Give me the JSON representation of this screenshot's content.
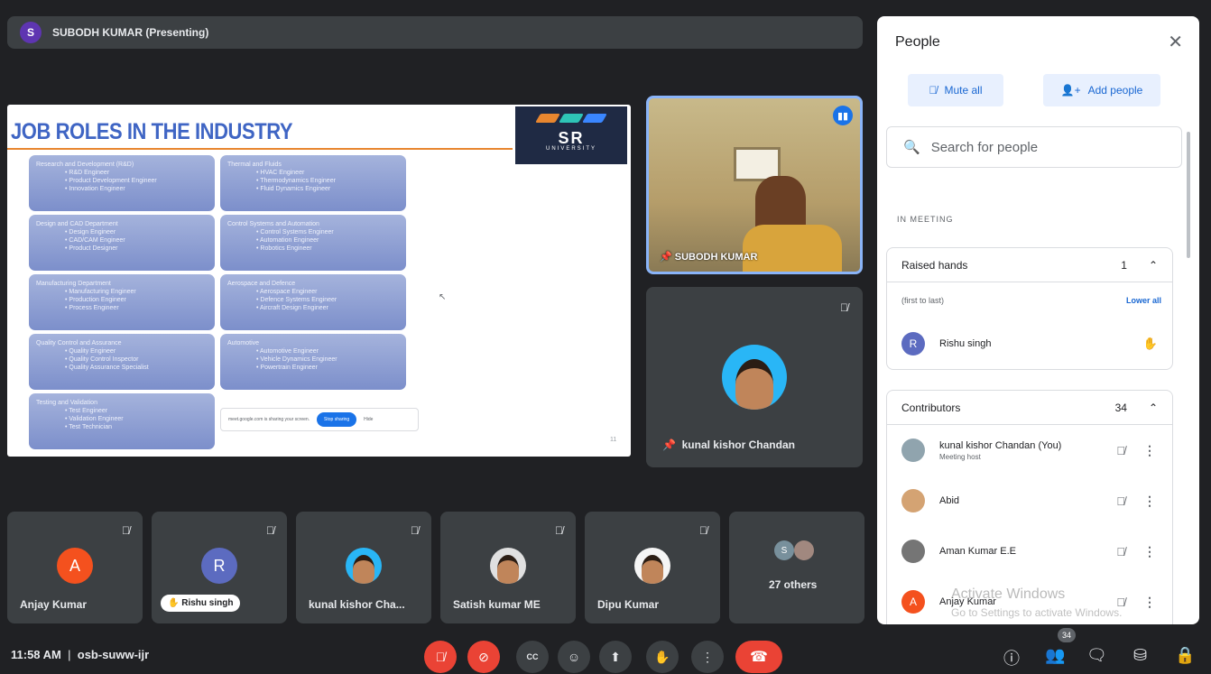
{
  "presenter": {
    "initial": "S",
    "label": "SUBODH KUMAR (Presenting)"
  },
  "slide": {
    "title": "JOB ROLES IN THE INDUSTRY",
    "logo": {
      "name": "SR",
      "sub": "UNIVERSITY"
    },
    "cards": [
      {
        "heading": "Research and Development (R&D)",
        "items": [
          "R&D Engineer",
          "Product Development Engineer",
          "Innovation Engineer"
        ]
      },
      {
        "heading": "Thermal and Fluids",
        "items": [
          "HVAC Engineer",
          "Thermodynamics Engineer",
          "Fluid Dynamics Engineer"
        ]
      },
      {
        "heading": "Design and CAD Department",
        "items": [
          "Design Engineer",
          "CAD/CAM Engineer",
          "Product Designer"
        ]
      },
      {
        "heading": "Control Systems and Automation",
        "items": [
          "Control Systems Engineer",
          "Automation Engineer",
          "Robotics Engineer"
        ]
      },
      {
        "heading": "Manufacturing Department",
        "items": [
          "Manufacturing Engineer",
          "Production Engineer",
          "Process Engineer"
        ]
      },
      {
        "heading": "Aerospace and Defence",
        "items": [
          "Aerospace Engineer",
          "Defence Systems Engineer",
          "Aircraft Design Engineer"
        ]
      },
      {
        "heading": "Quality Control and Assurance",
        "items": [
          "Quality Engineer",
          "Quality Control Inspector",
          "Quality Assurance Specialist"
        ]
      },
      {
        "heading": "Automotive",
        "items": [
          "Automotive Engineer",
          "Vehicle Dynamics Engineer",
          "Powertrain Engineer"
        ]
      },
      {
        "heading": "Testing and Validation",
        "items": [
          "Test Engineer",
          "Validation Engineer",
          "Test Technician"
        ]
      }
    ],
    "share_bar": {
      "text": "meet.google.com is sharing your screen.",
      "stop": "Stop sharing",
      "hide": "Hide"
    },
    "page_number": "11"
  },
  "tiles": {
    "subodh": {
      "name": "SUBODH KUMAR"
    },
    "kunal": {
      "name": "kunal kishor Chandan"
    }
  },
  "participants": [
    {
      "name": "Anjay Kumar",
      "initial": "A",
      "color": "#f4511e"
    },
    {
      "name": "Rishu singh",
      "initial": "R",
      "color": "#5c6bc0",
      "hand": true
    },
    {
      "name": "kunal kishor Cha...",
      "initial": "",
      "color": "#29b6f6"
    },
    {
      "name": "Satish kumar ME",
      "initial": "",
      "color": "#e0e0e0"
    },
    {
      "name": "Dipu Kumar",
      "initial": "",
      "color": "#f5f5f5"
    }
  ],
  "others": {
    "label": "27 others",
    "mini_initial": "S"
  },
  "controls": {
    "time": "11:58 AM",
    "separator": "|",
    "meeting_code": "osb-suww-ijr",
    "cc_label": "CC"
  },
  "panel": {
    "title": "People",
    "mute_all": "Mute all",
    "add_people": "Add people",
    "search_placeholder": "Search for people",
    "in_meeting": "IN MEETING",
    "people_badge": "34",
    "raised_hands": {
      "title": "Raised hands",
      "count": "1",
      "order": "(first to last)",
      "lower_all": "Lower all",
      "person": {
        "name": "Rishu singh",
        "initial": "R"
      }
    },
    "contributors": {
      "title": "Contributors",
      "count": "34",
      "people": [
        {
          "name": "kunal kishor Chandan (You)",
          "sub": "Meeting host"
        },
        {
          "name": "Abid",
          "sub": ""
        },
        {
          "name": "Aman Kumar E.E",
          "sub": ""
        },
        {
          "name": "Anjay Kumar",
          "sub": "",
          "initial": "A"
        }
      ]
    }
  },
  "watermark": {
    "title": "Activate Windows",
    "sub": "Go to Settings to activate Windows."
  },
  "colors": {
    "background": "#202124",
    "accent": "#1a73e8",
    "danger": "#ea4335",
    "tile": "#3c4043"
  }
}
